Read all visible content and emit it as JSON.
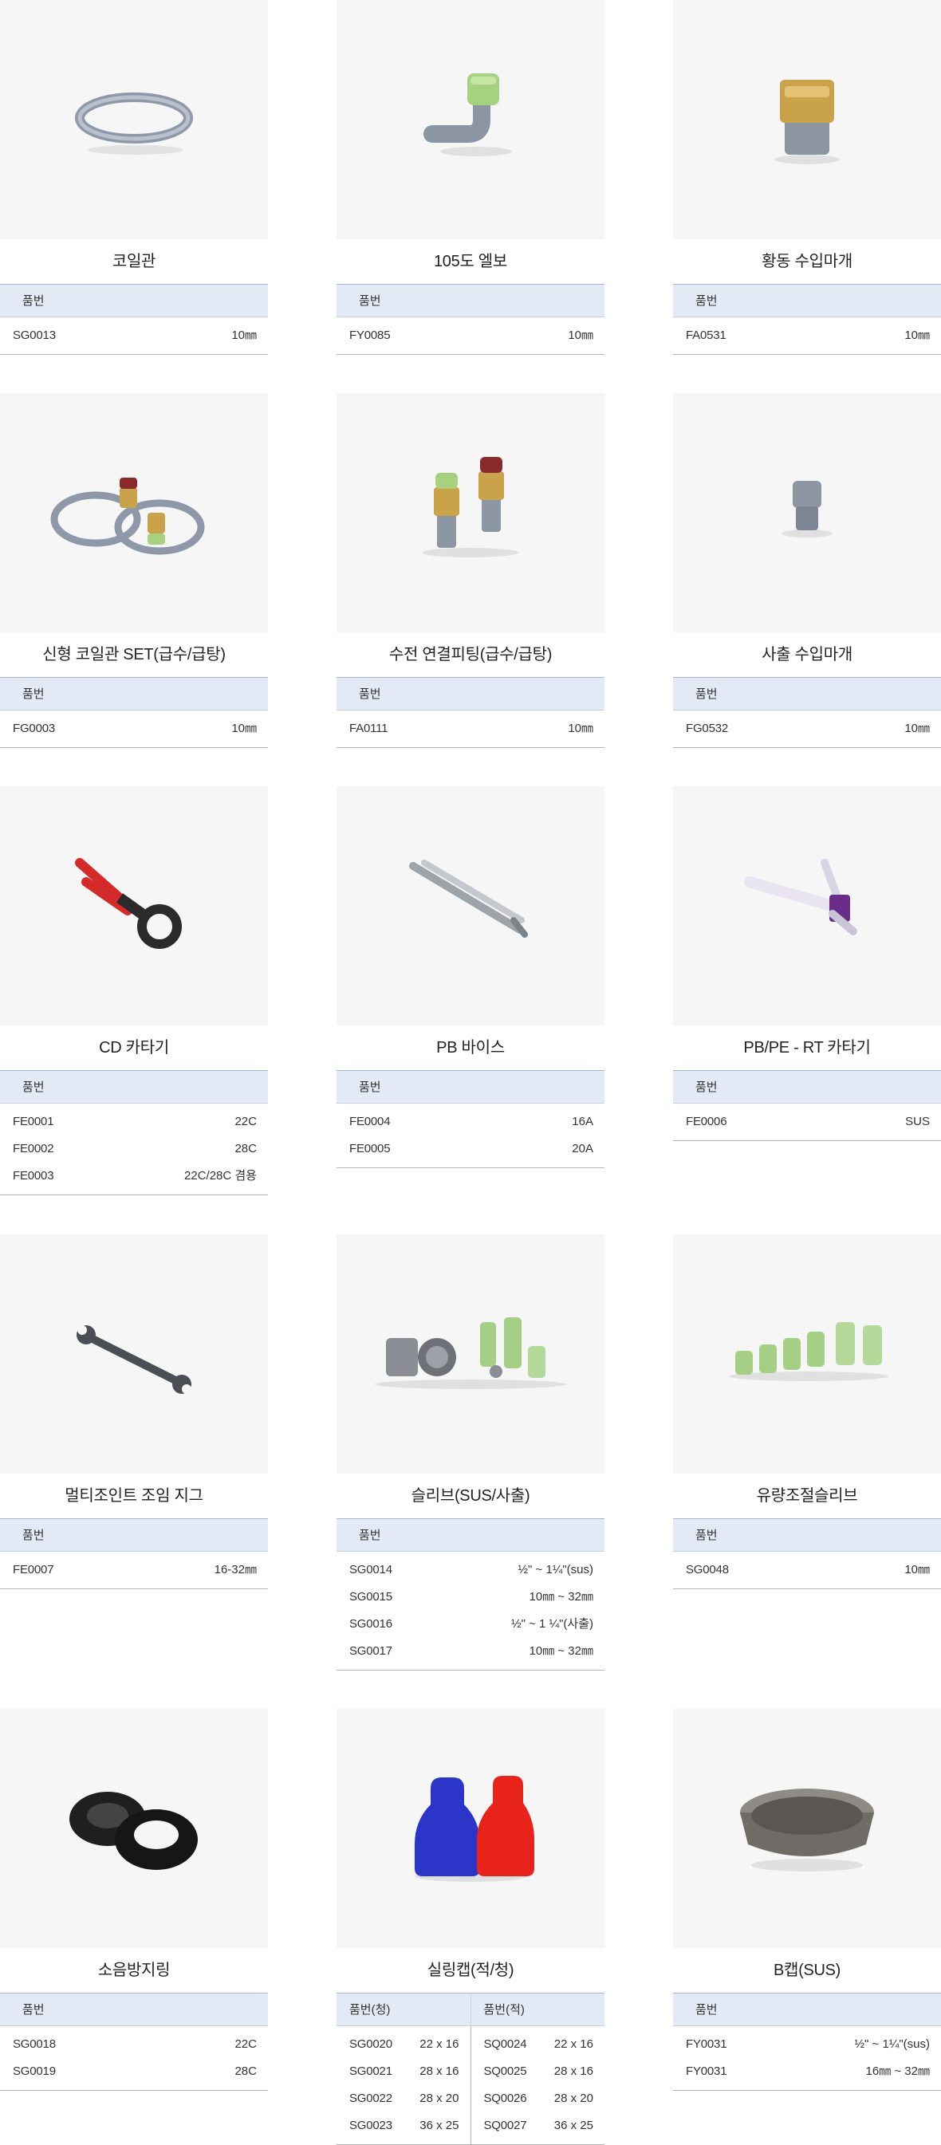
{
  "header_label": "품번",
  "products": [
    {
      "title": "코일관",
      "rows": [
        {
          "code": "SG0013",
          "value": "10㎜"
        }
      ]
    },
    {
      "title": "105도 엘보",
      "rows": [
        {
          "code": "FY0085",
          "value": "10㎜"
        }
      ]
    },
    {
      "title": "황동 수입마개",
      "rows": [
        {
          "code": "FA0531",
          "value": "10㎜"
        }
      ]
    },
    {
      "title": "신형 코일관 SET(급수/급탕)",
      "rows": [
        {
          "code": "FG0003",
          "value": "10㎜"
        }
      ]
    },
    {
      "title": "수전 연결피팅(급수/급탕)",
      "rows": [
        {
          "code": "FA0111",
          "value": "10㎜"
        }
      ]
    },
    {
      "title": "사출 수입마개",
      "rows": [
        {
          "code": "FG0532",
          "value": "10㎜"
        }
      ]
    },
    {
      "title": "CD 카타기",
      "rows": [
        {
          "code": "FE0001",
          "value": "22C"
        },
        {
          "code": "FE0002",
          "value": "28C"
        },
        {
          "code": "FE0003",
          "value": "22C/28C 겸용"
        }
      ]
    },
    {
      "title": "PB 바이스",
      "rows": [
        {
          "code": "FE0004",
          "value": "16A"
        },
        {
          "code": "FE0005",
          "value": "20A"
        }
      ]
    },
    {
      "title": "PB/PE - RT 카타기",
      "rows": [
        {
          "code": "FE0006",
          "value": "SUS"
        }
      ]
    },
    {
      "title": "멀티조인트 조임 지그",
      "rows": [
        {
          "code": "FE0007",
          "value": "16-32㎜"
        }
      ]
    },
    {
      "title": "슬리브(SUS/사출)",
      "rows": [
        {
          "code": "SG0014",
          "value": "½\" ~ 1¼\"(sus)"
        },
        {
          "code": "SG0015",
          "value": "10㎜ ~ 32㎜"
        },
        {
          "code": "SG0016",
          "value": "½\" ~ 1 ¼\"(사출)"
        },
        {
          "code": "SG0017",
          "value": "10㎜ ~ 32㎜"
        }
      ]
    },
    {
      "title": "유량조절슬리브",
      "rows": [
        {
          "code": "SG0048",
          "value": "10㎜"
        }
      ]
    },
    {
      "title": "소음방지링",
      "rows": [
        {
          "code": "SG0018",
          "value": "22C"
        },
        {
          "code": "SG0019",
          "value": "28C"
        }
      ]
    },
    {
      "title": "실링캡(적/청)",
      "split": true,
      "left_header": "품번(청)",
      "right_header": "품번(적)",
      "left_rows": [
        {
          "code": "SG0020",
          "value": "22 x 16"
        },
        {
          "code": "SG0021",
          "value": "28 x 16"
        },
        {
          "code": "SG0022",
          "value": "28 x 20"
        },
        {
          "code": "SG0023",
          "value": "36 x 25"
        }
      ],
      "right_rows": [
        {
          "code": "SQ0024",
          "value": "22 x 16"
        },
        {
          "code": "SQ0025",
          "value": "28 x 16"
        },
        {
          "code": "SQ0026",
          "value": "28 x 20"
        },
        {
          "code": "SQ0027",
          "value": "36 x 25"
        }
      ]
    },
    {
      "title": "B캡(SUS)",
      "rows": [
        {
          "code": "FY0031",
          "value": "½\" ~ 1¼\"(sus)"
        },
        {
          "code": "FY0031",
          "value": "16㎜ ~ 32㎜"
        }
      ]
    }
  ]
}
